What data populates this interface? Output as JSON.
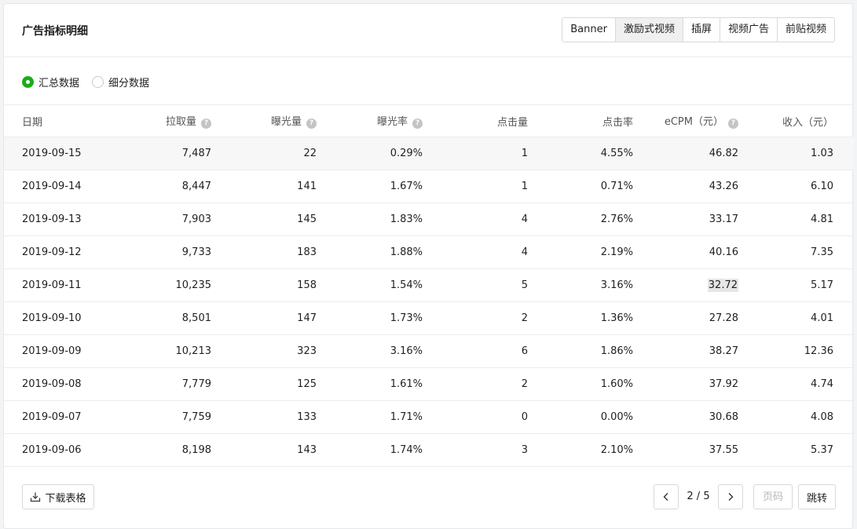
{
  "header": {
    "title": "广告指标明细",
    "tabs": [
      {
        "label": "Banner",
        "active": false
      },
      {
        "label": "激励式视频",
        "active": true
      },
      {
        "label": "插屏",
        "active": false
      },
      {
        "label": "视频广告",
        "active": false
      },
      {
        "label": "前贴视频",
        "active": false
      }
    ]
  },
  "mode": {
    "options": [
      {
        "label": "汇总数据",
        "checked": true
      },
      {
        "label": "细分数据",
        "checked": false
      }
    ]
  },
  "table": {
    "columns": [
      {
        "label": "日期",
        "help": false
      },
      {
        "label": "拉取量",
        "help": true
      },
      {
        "label": "曝光量",
        "help": true
      },
      {
        "label": "曝光率",
        "help": true
      },
      {
        "label": "点击量",
        "help": false
      },
      {
        "label": "点击率",
        "help": false
      },
      {
        "label": "eCPM（元）",
        "help": true
      },
      {
        "label": "收入（元）",
        "help": false
      }
    ],
    "help_glyph": "?",
    "rows": [
      [
        "2019-09-15",
        "7,487",
        "22",
        "0.29%",
        "1",
        "4.55%",
        "46.82",
        "1.03"
      ],
      [
        "2019-09-14",
        "8,447",
        "141",
        "1.67%",
        "1",
        "0.71%",
        "43.26",
        "6.10"
      ],
      [
        "2019-09-13",
        "7,903",
        "145",
        "1.83%",
        "4",
        "2.76%",
        "33.17",
        "4.81"
      ],
      [
        "2019-09-12",
        "9,733",
        "183",
        "1.88%",
        "4",
        "2.19%",
        "40.16",
        "7.35"
      ],
      [
        "2019-09-11",
        "10,235",
        "158",
        "1.54%",
        "5",
        "3.16%",
        "32.72",
        "5.17"
      ],
      [
        "2019-09-10",
        "8,501",
        "147",
        "1.73%",
        "2",
        "1.36%",
        "27.28",
        "4.01"
      ],
      [
        "2019-09-09",
        "10,213",
        "323",
        "3.16%",
        "6",
        "1.86%",
        "38.27",
        "12.36"
      ],
      [
        "2019-09-08",
        "7,779",
        "125",
        "1.61%",
        "2",
        "1.60%",
        "37.92",
        "4.74"
      ],
      [
        "2019-09-07",
        "7,759",
        "133",
        "1.71%",
        "0",
        "0.00%",
        "30.68",
        "4.08"
      ],
      [
        "2019-09-06",
        "8,198",
        "143",
        "1.74%",
        "3",
        "2.10%",
        "37.55",
        "5.37"
      ]
    ]
  },
  "footer": {
    "download_label": "下载表格",
    "download_icon": "download-icon",
    "prev_icon": "chevron-left-icon",
    "next_icon": "chevron-right-icon",
    "page_info": "2 / 5",
    "page_placeholder": "页码",
    "jump_label": "跳转"
  }
}
